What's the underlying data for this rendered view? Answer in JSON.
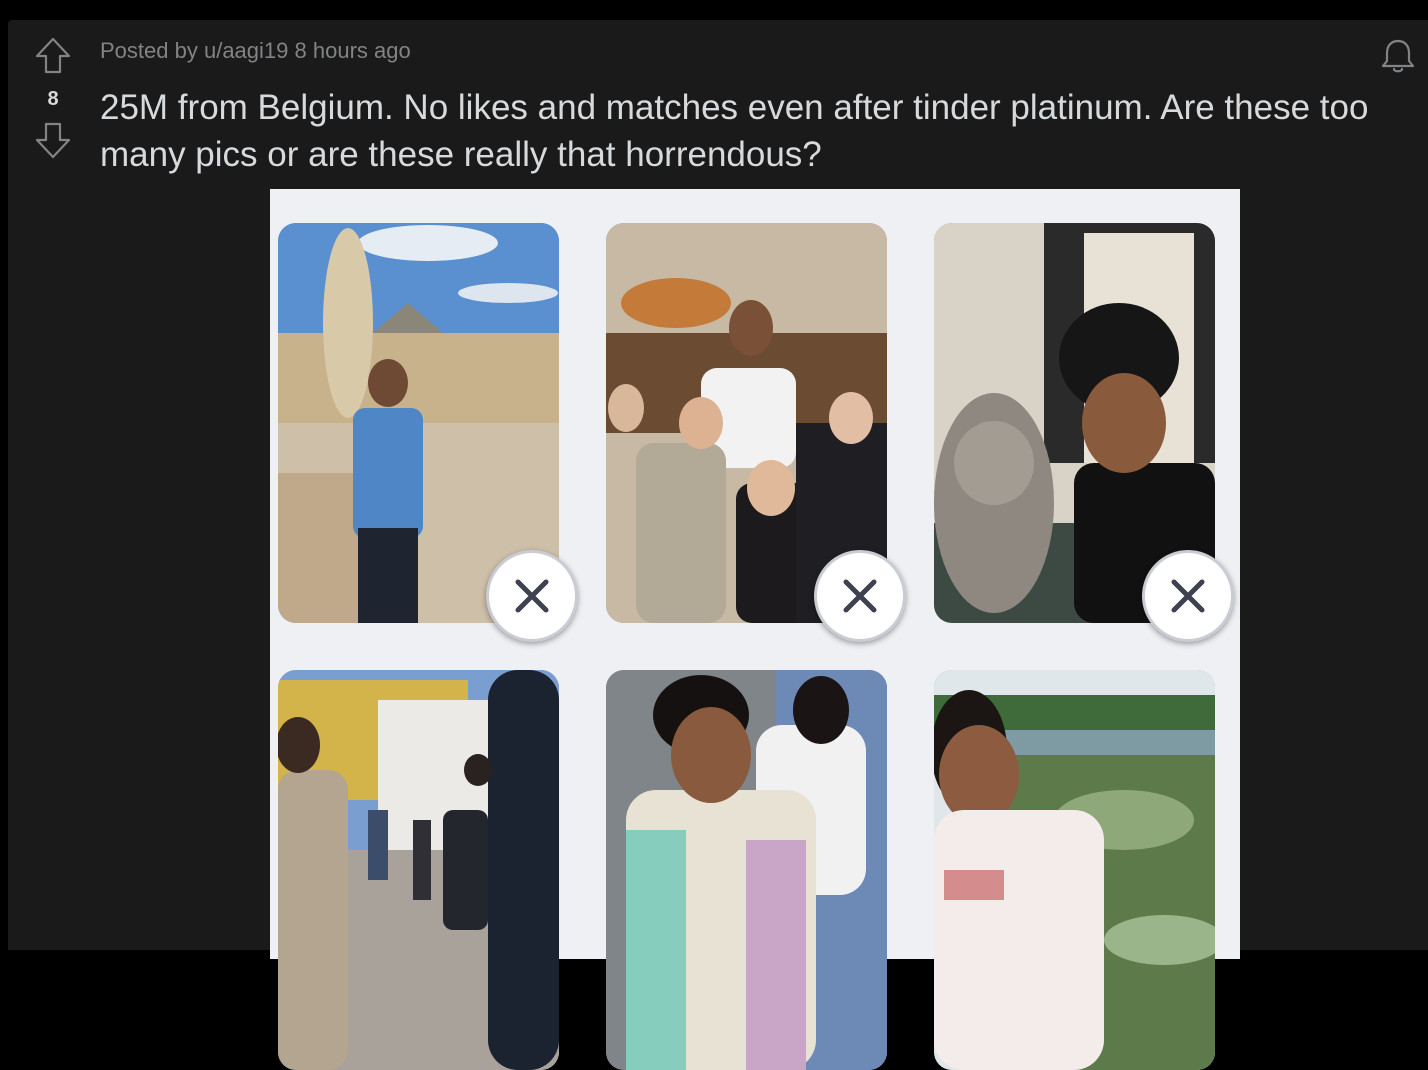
{
  "post": {
    "meta_prefix": "Posted by",
    "username": "u/aagi19",
    "time": "8 hours ago",
    "vote_count": "8",
    "title": "25M from Belgium. No likes and matches even after tinder platinum. Are these too many pics or are these really that horrendous?"
  },
  "icons": {
    "upvote": "upvote-arrow-icon",
    "downvote": "downvote-arrow-icon",
    "bell": "notification-bell-icon",
    "remove": "close-x-icon"
  },
  "colors": {
    "page_background": "#000000",
    "post_background": "#1a1a1b",
    "text_primary": "#d7dadc",
    "text_meta": "#818384",
    "media_background": "#eef0f4",
    "remove_x": "#3d4150"
  },
  "photos": [
    {
      "name": "photo-louvre-statue"
    },
    {
      "name": "photo-group-friends"
    },
    {
      "name": "photo-selfie-cat"
    },
    {
      "name": "photo-street-crowd"
    },
    {
      "name": "photo-sitting-crowd"
    },
    {
      "name": "photo-palace-garden"
    }
  ]
}
